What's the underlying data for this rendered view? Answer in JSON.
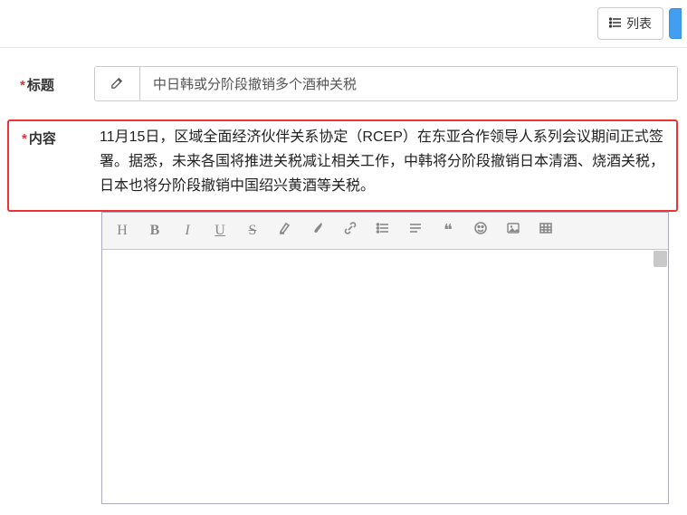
{
  "header": {
    "list_button_label": "列表"
  },
  "form": {
    "title_label": "标题",
    "title_value": "中日韩或分阶段撤销多个酒种关税",
    "content_label": "内容",
    "content_text": "11月15日，区域全面经济伙伴关系协定（RCEP）在东亚合作领导人系列会议期间正式签署。据悉，未来各国将推进关税减让相关工作，中韩将分阶段撤销日本清酒、烧酒关税，日本也将分阶段撤销中国绍兴黄酒等关税。"
  },
  "toolbar": {
    "heading": "H",
    "bold": "B",
    "italic": "I",
    "underline": "U",
    "strike": "S",
    "quote_glyph": "❝"
  }
}
